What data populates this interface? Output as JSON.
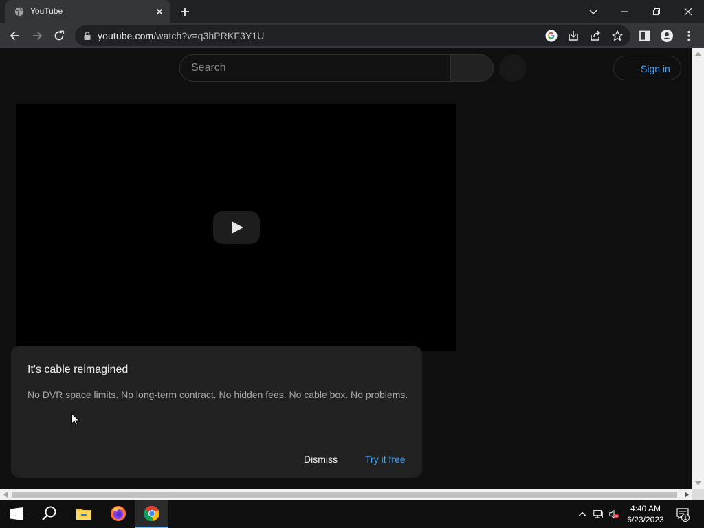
{
  "browser": {
    "tab_title": "YouTube",
    "url_host": "youtube.com",
    "url_path": "/watch?v=q3hPRKF3Y1U"
  },
  "youtube": {
    "search_placeholder": "Search",
    "signin_label": "Sign in"
  },
  "dialog": {
    "heading": "It's cable reimagined",
    "body": "No DVR space limits. No long-term contract. No hidden fees. No cable box. No problems.",
    "dismiss_label": "Dismiss",
    "try_label": "Try it free"
  },
  "taskbar": {
    "time": "4:40 AM",
    "date": "6/23/2023",
    "notification_count": "1",
    "apps": [
      "start-icon",
      "search-icon",
      "file-explorer-icon",
      "firefox-icon",
      "chrome-icon"
    ]
  },
  "colors": {
    "accent_blue": "#3ea6ff",
    "page_bg": "#0f0f0f",
    "dialog_bg": "#212121"
  }
}
